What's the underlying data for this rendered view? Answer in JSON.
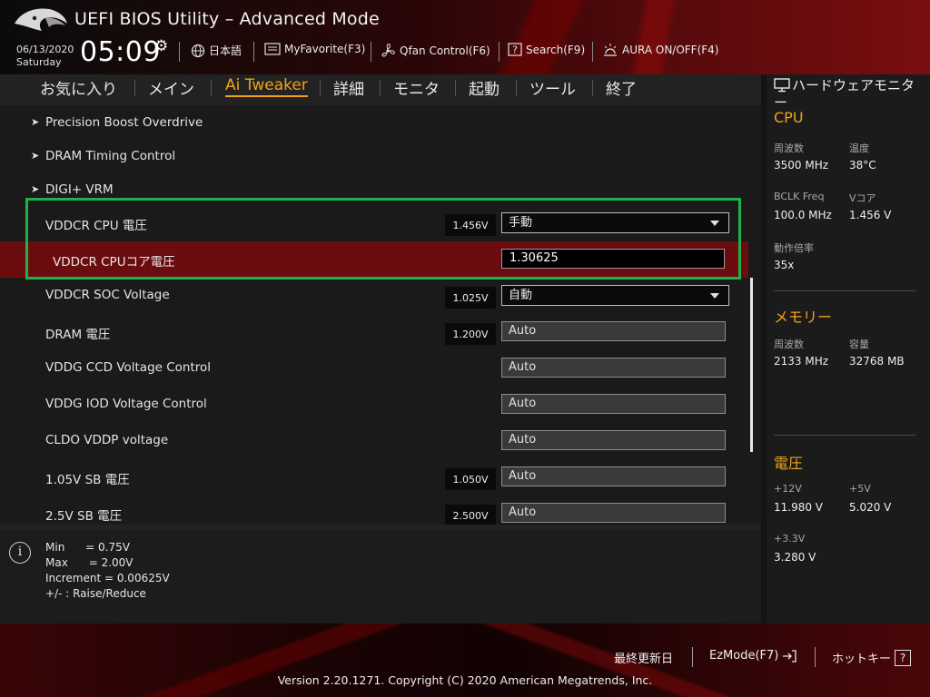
{
  "header": {
    "title": "UEFI BIOS Utility – Advanced Mode",
    "date": "06/13/2020",
    "day": "Saturday",
    "time": "05:09",
    "buttons": {
      "language": "日本語",
      "myfavorite": "MyFavorite(F3)",
      "qfan": "Qfan Control(F6)",
      "search": "Search(F9)",
      "aura": "AURA ON/OFF(F4)"
    }
  },
  "tabs": [
    {
      "label": "お気に入り",
      "active": false
    },
    {
      "label": "メイン",
      "active": false
    },
    {
      "label": "Ai Tweaker",
      "active": true
    },
    {
      "label": "詳細",
      "active": false
    },
    {
      "label": "モニタ",
      "active": false
    },
    {
      "label": "起動",
      "active": false
    },
    {
      "label": "ツール",
      "active": false
    },
    {
      "label": "終了",
      "active": false
    }
  ],
  "settings": [
    {
      "label": "Precision Boost Overdrive",
      "submenu": true
    },
    {
      "label": "DRAM Timing Control",
      "submenu": true
    },
    {
      "label": "DIGI+ VRM",
      "submenu": true
    },
    {
      "label": "VDDCR CPU 電圧",
      "voltage": "1.456V",
      "control": "select",
      "value": "手動"
    },
    {
      "label": "VDDCR CPUコア電圧",
      "control": "text",
      "value": "1.30625",
      "selected": true
    },
    {
      "label": "VDDCR SOC Voltage",
      "voltage": "1.025V",
      "control": "select",
      "value": "自動"
    },
    {
      "label": "DRAM 電圧",
      "voltage": "1.200V",
      "control": "auto",
      "value": "Auto"
    },
    {
      "label": "VDDG CCD Voltage Control",
      "control": "auto",
      "value": "Auto"
    },
    {
      "label": "VDDG IOD Voltage Control",
      "control": "auto",
      "value": "Auto"
    },
    {
      "label": "CLDO VDDP voltage",
      "control": "auto",
      "value": "Auto"
    },
    {
      "label": "1.05V SB 電圧",
      "voltage": "1.050V",
      "control": "auto",
      "value": "Auto"
    },
    {
      "label": "2.5V SB 電圧",
      "voltage": "2.500V",
      "control": "auto",
      "value": "Auto"
    }
  ],
  "help": {
    "lines": [
      "Min      = 0.75V",
      "Max      = 2.00V",
      "Increment = 0.00625V",
      "+/- : Raise/Reduce"
    ]
  },
  "monitor": {
    "title": "ハードウェアモニター",
    "cpu": {
      "title": "CPU",
      "freq_label": "周波数",
      "freq": "3500 MHz",
      "temp_label": "温度",
      "temp": "38°C",
      "bclk_label": "BCLK Freq",
      "bclk": "100.0 MHz",
      "vcore_label": "Vコア",
      "vcore": "1.456 V",
      "ratio_label": "動作倍率",
      "ratio": "35x"
    },
    "memory": {
      "title": "メモリー",
      "freq_label": "周波数",
      "freq": "2133 MHz",
      "cap_label": "容量",
      "cap": "32768 MB"
    },
    "voltage": {
      "title": "電圧",
      "v12_label": "+12V",
      "v12": "11.980 V",
      "v5_label": "+5V",
      "v5": "5.020 V",
      "v33_label": "+3.3V",
      "v33": "3.280 V"
    }
  },
  "footer": {
    "last_modified": "最終更新日",
    "ezmode": "EzMode(F7)",
    "hotkeys": "ホットキー",
    "hotkeys_symbol": "?",
    "copyright": "Version 2.20.1271. Copyright (C) 2020 American Megatrends, Inc."
  },
  "colors": {
    "accent": "#f0a21a",
    "selected_row": "#6b0c0f",
    "highlight_box": "#1db34a"
  }
}
